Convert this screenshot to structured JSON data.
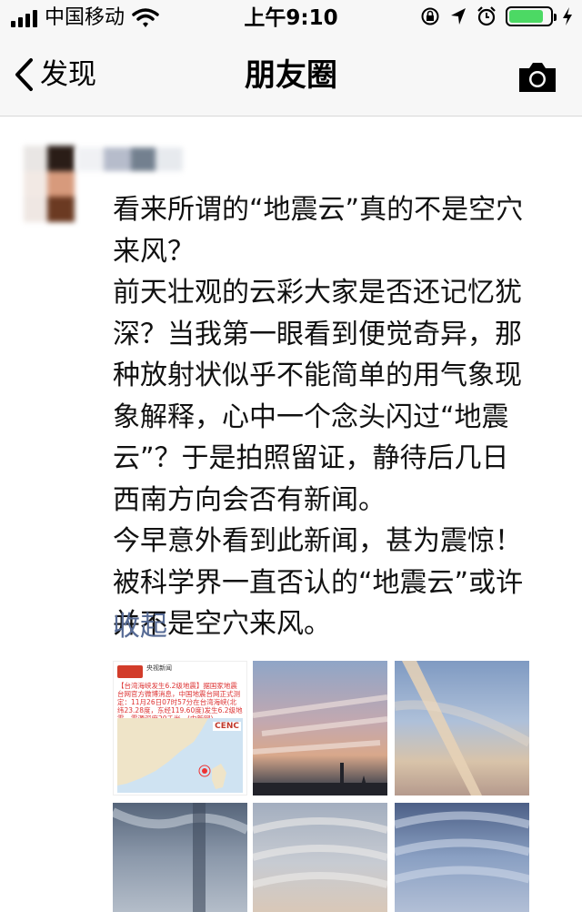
{
  "status_bar": {
    "carrier": "中国移动",
    "time": "上午9:10",
    "battery_level": 0.85,
    "signal_bars": 4
  },
  "nav": {
    "back_label": "发现",
    "title": "朋友圈"
  },
  "post": {
    "text": "看来所谓的“地震云”真的不是空穴\n来风？\n前天壮观的云彩大家是否还记忆犹\n深？当我第一眼看到便觉奇异，那\n种放射状似乎不能简单的用气象现\n象解释，心中一个念头闪过“地震\n云”？于是拍照留证，静待后几日\n西南方向会否有新闻。\n今早意外看到此新闻，甚为震惊！\n被科学界一直否认的“地震云”或许\n并不是空穴来风。",
    "collapse_label": "收起"
  },
  "news_thumb": {
    "source": "央视新闻",
    "body": "【台湾海峡发生6.2级地震】据国家地震台网官方微博消息，中国地震台网正式测定：11月26日07时57分在台湾海峡(北纬23.28度，东经119.60度)发生6.2级地震，震源深度20千米。(中新网)",
    "map_logo": "CENC"
  },
  "colors": {
    "link": "#576b95",
    "bar_bg": "#f7f7f7",
    "battery_green": "#4cd964"
  }
}
